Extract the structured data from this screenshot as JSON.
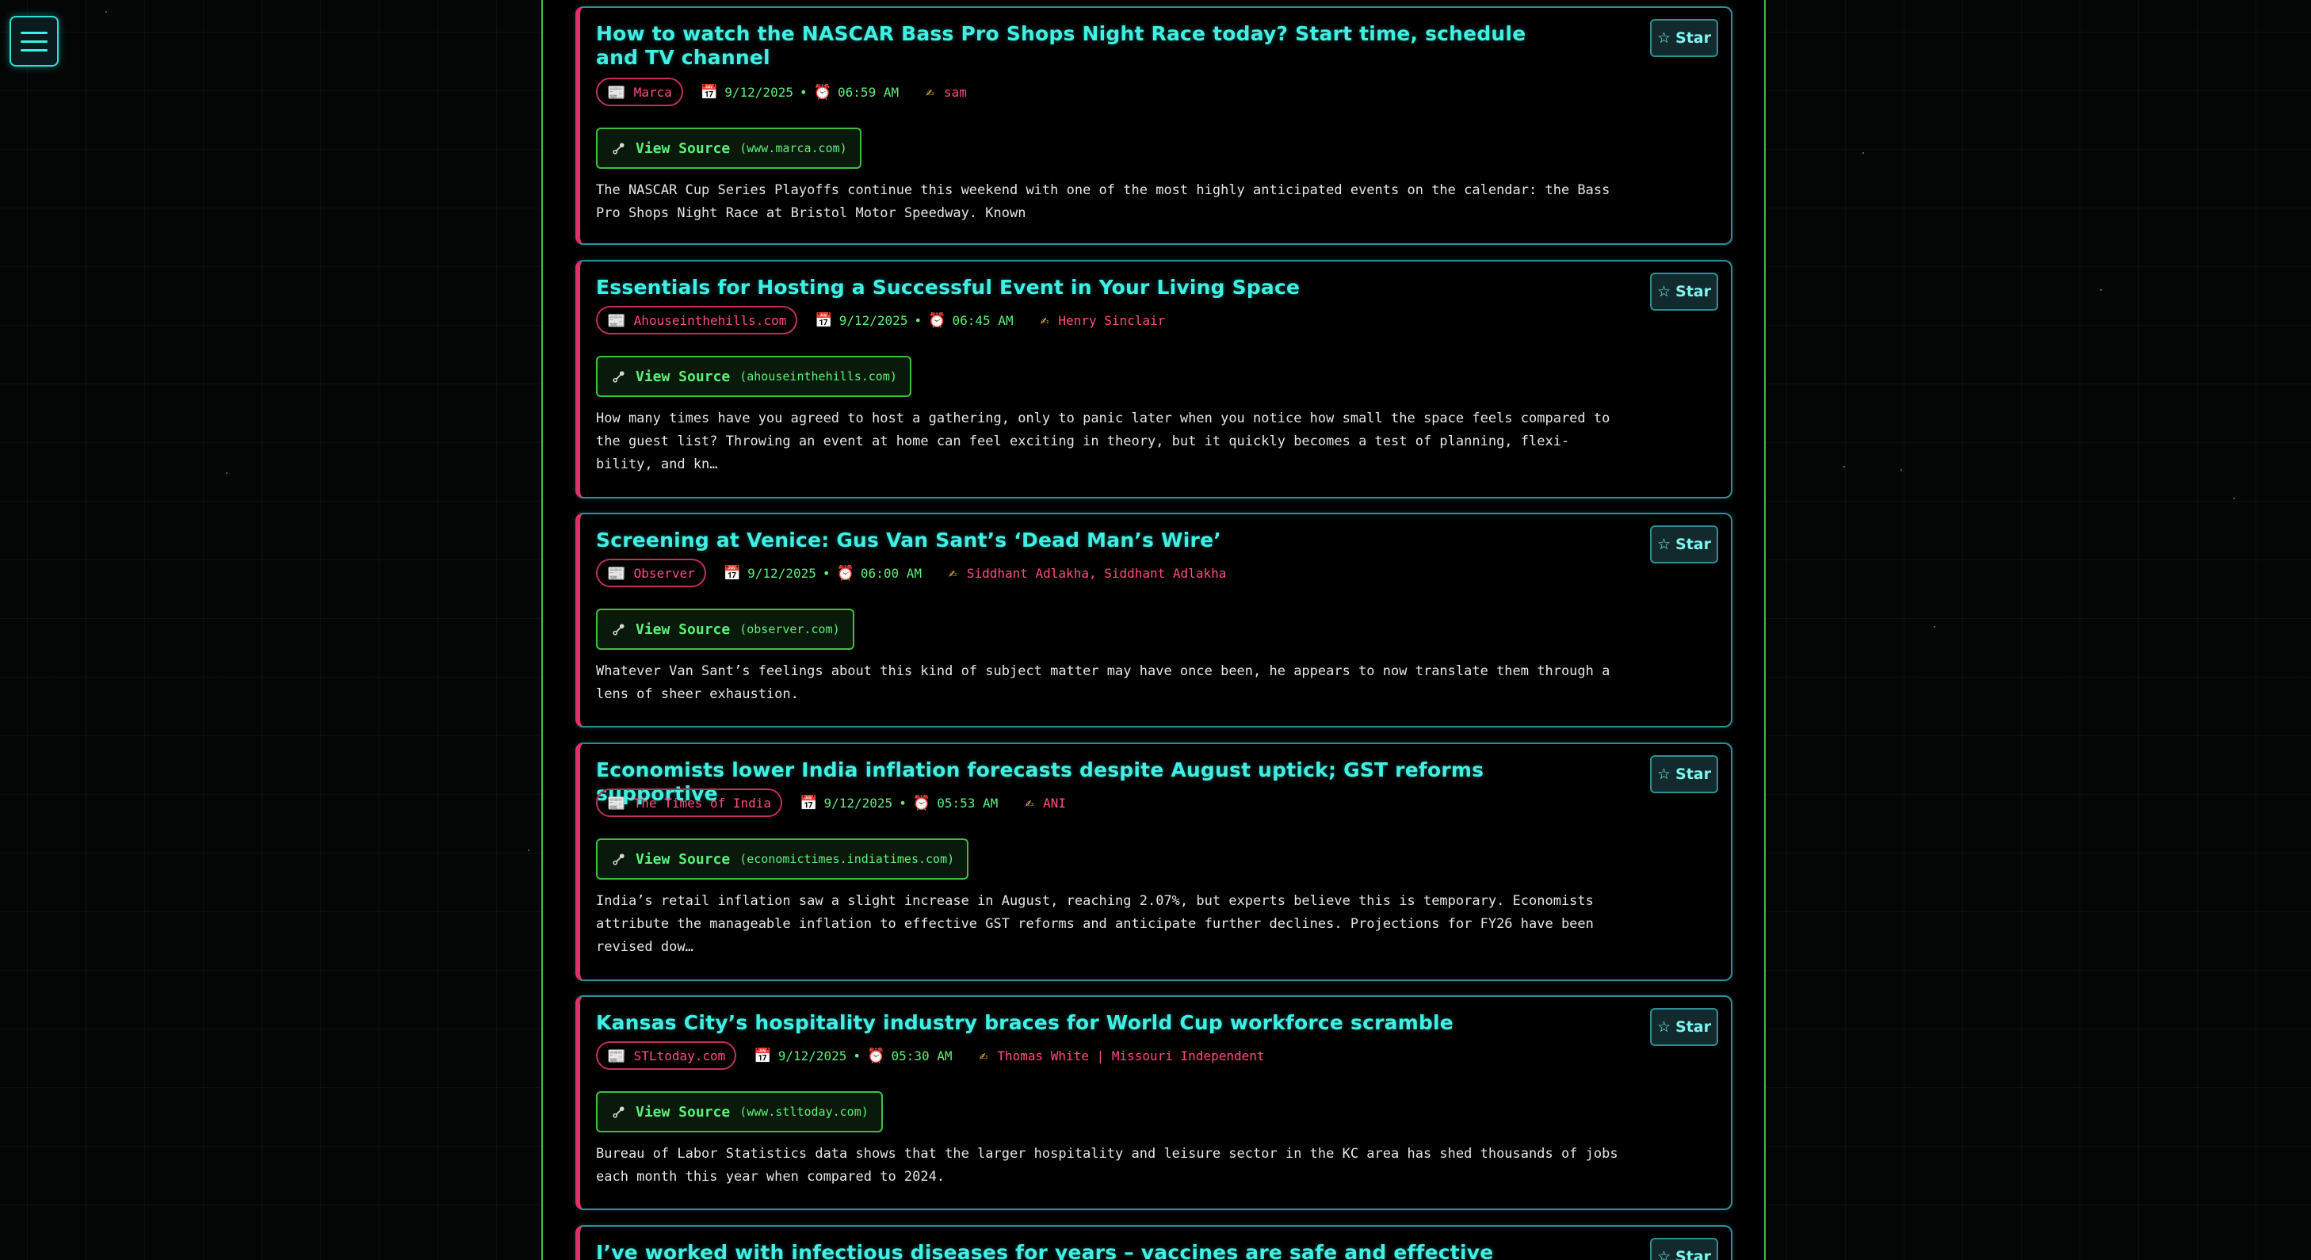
{
  "menu": {
    "label": "menu"
  },
  "star_label": "Star",
  "view_source_label": "View Source",
  "articles": [
    {
      "title": "How to watch the NASCAR Bass Pro Shops Night Race today? Start time, schedule and TV channel",
      "source": "Marca",
      "date": "9/12/2025",
      "time": "06:59 AM",
      "author": "sam",
      "domain": "(www.marca.com)",
      "summary": "The NASCAR Cup Series Playoffs continue this weekend with one of the most highly anticipated events on the calendar: the Bass Pro Shops Night Race at Bristol Motor Speedway. Known"
    },
    {
      "title": "Essentials for Hosting a Successful Event in Your Living Space",
      "source": "Ahouseinthehills.com",
      "date": "9/12/2025",
      "time": "06:45 AM",
      "author": "Henry Sinclair",
      "domain": "(ahouseinthehills.com)",
      "summary": "How many times have you agreed to host a gathering, only to panic later when you notice how small the space feels compared to the guest list? Throwing an event at home can feel exciting in theory, but it quickly becomes a test of planning, flexi-bility, and kn…"
    },
    {
      "title": "Screening at Venice: Gus Van Sant’s ‘Dead Man’s Wire’",
      "source": "Observer",
      "date": "9/12/2025",
      "time": "06:00 AM",
      "author": "Siddhant Adlakha, Siddhant Adlakha",
      "domain": "(observer.com)",
      "summary": "Whatever Van Sant’s feelings about this kind of subject matter may have once been, he appears to now translate them through a lens of sheer exhaustion."
    },
    {
      "title": "Economists lower India inflation forecasts despite August uptick; GST reforms supportive",
      "source": "The Times of India",
      "date": "9/12/2025",
      "time": "05:53 AM",
      "author": "ANI",
      "domain": "(economictimes.indiatimes.com)",
      "summary": "India’s retail inflation saw a slight increase in August, reaching 2.07%, but experts believe this is temporary. Economists attribute the manageable inflation to effective GST reforms and anticipate further declines. Projections for FY26 have been revised dow…"
    },
    {
      "title": "Kansas City’s hospitality industry braces for World Cup workforce scramble",
      "source": "STLtoday.com",
      "date": "9/12/2025",
      "time": "05:30 AM",
      "author": "Thomas White | Missouri Independent",
      "domain": "(www.stltoday.com)",
      "summary": "Bureau of Labor Statistics data shows that the larger hospitality and leisure sector in the KC area has shed thousands of jobs each month this year when compared to 2024."
    },
    {
      "title": "I’ve worked with infectious diseases for years – vaccines are safe and effective",
      "source": "",
      "date": "",
      "time": "",
      "author": "",
      "domain": "",
      "summary": ""
    }
  ]
}
